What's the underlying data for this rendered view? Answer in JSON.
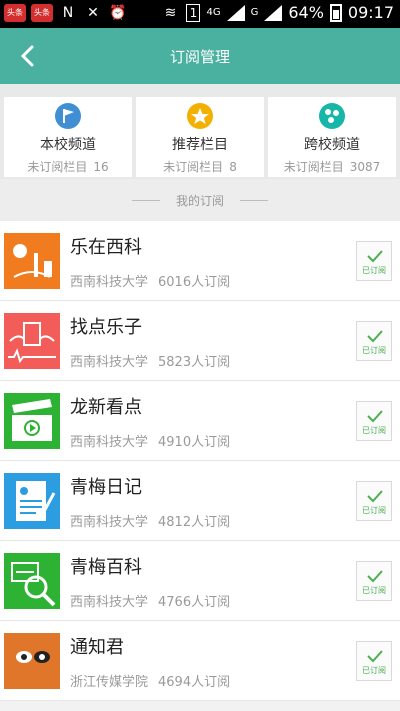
{
  "statusbar": {
    "app1": "头条",
    "app2": "头条",
    "carrier": "N",
    "lte": "4G",
    "g": "G",
    "sim": "1",
    "battery": "64%",
    "time": "09:17"
  },
  "header": {
    "title": "订阅管理"
  },
  "tabs": [
    {
      "label": "本校频道",
      "meta_label": "未订阅栏目",
      "count": "16",
      "color": "#3f8fd2",
      "icon": "flag-icon"
    },
    {
      "label": "推荐栏目",
      "meta_label": "未订阅栏目",
      "count": "8",
      "color": "#f4b000",
      "icon": "star-icon"
    },
    {
      "label": "跨校频道",
      "meta_label": "未订阅栏目",
      "count": "3087",
      "color": "#16b6a8",
      "icon": "network-icon"
    }
  ],
  "section": {
    "title": "我的订阅"
  },
  "items": [
    {
      "title": "乐在西科",
      "school": "西南科技大学",
      "subscribers": "6016人订阅",
      "button": "已订阅",
      "color": "#f17b1f"
    },
    {
      "title": "找点乐子",
      "school": "西南科技大学",
      "subscribers": "5823人订阅",
      "button": "已订阅",
      "color": "#f25d5a"
    },
    {
      "title": "龙新看点",
      "school": "西南科技大学",
      "subscribers": "4910人订阅",
      "button": "已订阅",
      "color": "#2db233"
    },
    {
      "title": "青梅日记",
      "school": "西南科技大学",
      "subscribers": "4812人订阅",
      "button": "已订阅",
      "color": "#2c9de0"
    },
    {
      "title": "青梅百科",
      "school": "西南科技大学",
      "subscribers": "4766人订阅",
      "button": "已订阅",
      "color": "#2db233"
    },
    {
      "title": "通知君",
      "school": "浙江传媒学院",
      "subscribers": "4694人订阅",
      "button": "已订阅",
      "color": "#e0762a"
    }
  ]
}
